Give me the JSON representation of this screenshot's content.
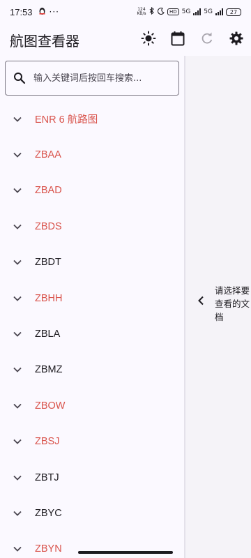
{
  "status_bar": {
    "time": "17:53",
    "more": "···",
    "net_speed_top": "124",
    "net_speed_unit": "KB/s",
    "hd_badge": "HD",
    "sim1_label": "5G",
    "sim2_label": "5G",
    "battery": "27"
  },
  "app_bar": {
    "title": "航图查看器"
  },
  "search": {
    "placeholder": "输入关键词后按回车搜索...",
    "value": ""
  },
  "list": {
    "items": [
      {
        "label": "ENR 6 航路图",
        "color": "#d9534b"
      },
      {
        "label": "ZBAA",
        "color": "#d9534b"
      },
      {
        "label": "ZBAD",
        "color": "#d9534b"
      },
      {
        "label": "ZBDS",
        "color": "#d9534b"
      },
      {
        "label": "ZBDT",
        "color": "#1d1b20"
      },
      {
        "label": "ZBHH",
        "color": "#d9534b"
      },
      {
        "label": "ZBLA",
        "color": "#1d1b20"
      },
      {
        "label": "ZBMZ",
        "color": "#1d1b20"
      },
      {
        "label": "ZBOW",
        "color": "#d9534b"
      },
      {
        "label": "ZBSJ",
        "color": "#d9534b"
      },
      {
        "label": "ZBTJ",
        "color": "#1d1b20"
      },
      {
        "label": "ZBYC",
        "color": "#1d1b20"
      },
      {
        "label": "ZBYN",
        "color": "#d9534b"
      }
    ]
  },
  "detail": {
    "hint": "请选择要查看的文档"
  },
  "icons": {
    "theme": "sun-icon",
    "calendar": "calendar-icon",
    "refresh": "refresh-icon",
    "settings": "gear-icon",
    "search": "search-icon",
    "expand": "chevron-down-icon",
    "back": "chevron-left-icon"
  },
  "colors": {
    "accent_red": "#d9534b",
    "text": "#1d1b20",
    "background": "#fbf9ff"
  }
}
